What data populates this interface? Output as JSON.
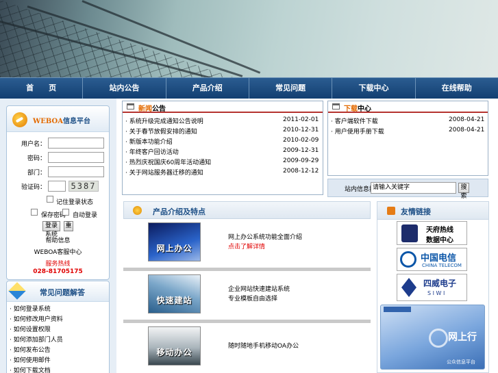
{
  "nav": [
    "首　　页",
    "站内公告",
    "产品介绍",
    "常见问题",
    "下载中心",
    "在线帮助"
  ],
  "login": {
    "brand_en": "WEBOA",
    "brand_cn": "信息平台",
    "fields": [
      "用户名：",
      "密码：",
      "部门：",
      "验证码："
    ],
    "captcha": "5387",
    "remember": "记住登录状态",
    "opt1": "保存密码",
    "opt2": "自动登录",
    "btn_login": "登录系统",
    "btn_reset": "重",
    "help": "帮助信息",
    "service": "WEBOA客服中心",
    "hotline_label": "服务热线",
    "phone": "028-81705175"
  },
  "faq": {
    "title": "常见问题解答",
    "items": [
      "如何登录系统",
      "如何修改用户资料",
      "如何设置权限",
      "如何添加部门人员",
      "如何发布公告",
      "如何使用邮件",
      "如何下载文档"
    ]
  },
  "news": {
    "title_hl": "新闻",
    "title": "公告",
    "rows": [
      {
        "t": "系统升级完成通知公告说明",
        "d": "2011-02-01"
      },
      {
        "t": "关于春节放假安排的通知",
        "d": "2010-12-31"
      },
      {
        "t": "新版本功能介绍",
        "d": "2010-02-09"
      },
      {
        "t": "年终客户回访活动",
        "d": "2009-12-31"
      },
      {
        "t": "热烈庆祝国庆60周年活动通知",
        "d": "2009-09-29"
      },
      {
        "t": "关于网站服务器迁移的通知",
        "d": "2008-12-12"
      }
    ]
  },
  "download": {
    "title_hl": "下载",
    "title": "中心",
    "rows": [
      {
        "t": "客户端软件下载",
        "d": "2008-04-21"
      },
      {
        "t": "用户使用手册下载",
        "d": "2008-04-21"
      }
    ]
  },
  "search": {
    "label": "站内信息搜索：",
    "placeholder": "请输入关键字",
    "button": "搜索"
  },
  "products": {
    "title": "产品介绍及特点",
    "items": [
      {
        "img": "网上办公",
        "line1": "网上办公系统功能全面介绍",
        "line2": "点击了解详情"
      },
      {
        "img": "快速建站",
        "line1": "企业网站快速建站系统",
        "line2": "专业模板自由选择"
      },
      {
        "img": "移动办公",
        "line1": "随时随地手机移动OA办公",
        "line2": ""
      }
    ]
  },
  "links": {
    "title": "友情链接",
    "l1a": "天府热线",
    "l1b": "数据中心",
    "l2cn": "中国电信",
    "l2en": "CHINA TELECOM",
    "l3cn": "四威电子",
    "l3en": "S I W I",
    "l4": "网上行",
    "l4sub": "公众信息平台"
  },
  "colors": {
    "nav": "#1c4a7c",
    "accent": "#b5322e",
    "brand": "#e36a00",
    "phone": "#e00000"
  }
}
